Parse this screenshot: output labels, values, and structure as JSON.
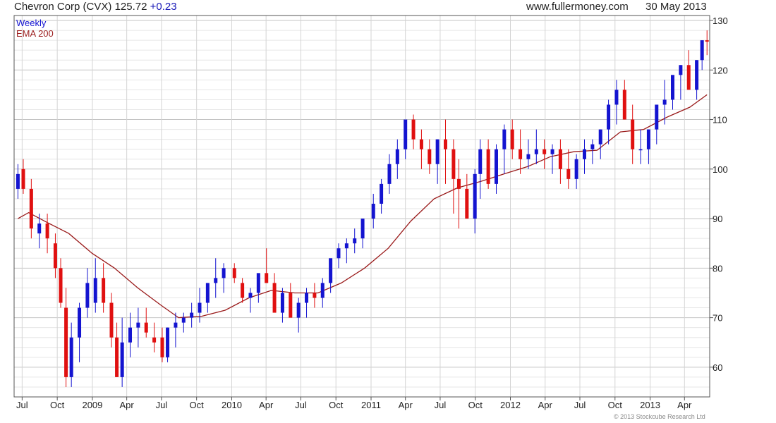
{
  "header": {
    "title": "Chevron Corp (CVX)",
    "last": "125.72",
    "change": "+0.23",
    "site": "www.fullermoney.com",
    "date": "30 May 2013"
  },
  "footer": {
    "copyright": "© 2013 Stockcube Research Ltd"
  },
  "colors": {
    "up": "#1414d0",
    "down": "#e01010",
    "ema": "#9a1b1b",
    "grid": "#cfcfcf"
  },
  "chart_data": {
    "type": "line",
    "legend": [
      "Weekly",
      "EMA 200"
    ],
    "legend_position": "top-left",
    "y_axis_position": "right",
    "grid": true,
    "ylim": [
      54,
      131
    ],
    "y_ticks": [
      60,
      70,
      80,
      90,
      100,
      110,
      120,
      130
    ],
    "x_ticks": [
      "Jul",
      "Oct",
      "2009",
      "Apr",
      "Jul",
      "Oct",
      "2010",
      "Apr",
      "Jul",
      "Oct",
      "2011",
      "Apr",
      "Jul",
      "Oct",
      "2012",
      "Apr",
      "Jul",
      "Oct",
      "2013",
      "Apr"
    ],
    "x_tick_dates": [
      "2008-07-01",
      "2008-10-01",
      "2009-01-01",
      "2009-04-01",
      "2009-07-01",
      "2009-10-01",
      "2010-01-01",
      "2010-04-01",
      "2010-07-01",
      "2010-10-01",
      "2011-01-01",
      "2011-04-01",
      "2011-07-01",
      "2011-10-01",
      "2012-01-01",
      "2012-04-01",
      "2012-07-01",
      "2012-10-01",
      "2013-01-01",
      "2013-04-01"
    ],
    "series": [
      {
        "name": "Weekly",
        "style": "candlestick",
        "dates": [
          "2008-06-20",
          "2008-07-04",
          "2008-07-25",
          "2008-08-15",
          "2008-09-05",
          "2008-09-26",
          "2008-10-10",
          "2008-10-24",
          "2008-11-07",
          "2008-11-28",
          "2008-12-19",
          "2009-01-09",
          "2009-01-30",
          "2009-02-20",
          "2009-03-06",
          "2009-03-20",
          "2009-04-10",
          "2009-05-01",
          "2009-05-22",
          "2009-06-12",
          "2009-07-03",
          "2009-07-17",
          "2009-08-07",
          "2009-08-28",
          "2009-09-18",
          "2009-10-09",
          "2009-10-30",
          "2009-11-20",
          "2009-12-11",
          "2010-01-08",
          "2010-01-29",
          "2010-02-19",
          "2010-03-12",
          "2010-04-02",
          "2010-04-23",
          "2010-05-14",
          "2010-06-04",
          "2010-06-25",
          "2010-07-16",
          "2010-08-06",
          "2010-08-27",
          "2010-09-17",
          "2010-10-08",
          "2010-10-29",
          "2010-11-19",
          "2010-12-10",
          "2011-01-07",
          "2011-01-28",
          "2011-02-18",
          "2011-03-11",
          "2011-04-01",
          "2011-04-22",
          "2011-05-13",
          "2011-06-03",
          "2011-06-24",
          "2011-07-15",
          "2011-08-05",
          "2011-08-19",
          "2011-09-09",
          "2011-09-30",
          "2011-10-14",
          "2011-11-04",
          "2011-11-25",
          "2011-12-16",
          "2012-01-06",
          "2012-01-27",
          "2012-02-17",
          "2012-03-09",
          "2012-03-30",
          "2012-04-20",
          "2012-05-11",
          "2012-06-01",
          "2012-06-22",
          "2012-07-13",
          "2012-08-03",
          "2012-08-24",
          "2012-09-14",
          "2012-10-05",
          "2012-10-26",
          "2012-11-16",
          "2012-12-07",
          "2012-12-28",
          "2013-01-18",
          "2013-02-08",
          "2013-03-01",
          "2013-03-22",
          "2013-04-12",
          "2013-05-03",
          "2013-05-17",
          "2013-05-30"
        ],
        "open": [
          96,
          100,
          96,
          87,
          89,
          85,
          80,
          72,
          58,
          66,
          72,
          73,
          78,
          73,
          66,
          58,
          65,
          68,
          69,
          66,
          66,
          62,
          68,
          69,
          70,
          71,
          73,
          77,
          78,
          80,
          77,
          74,
          75,
          79,
          77,
          71,
          75,
          70,
          73,
          75,
          74,
          77,
          82,
          84,
          85,
          86,
          90,
          93,
          97,
          101,
          104,
          110,
          106,
          104,
          101,
          106,
          104,
          98,
          96,
          90,
          99,
          104,
          97,
          104,
          108,
          104,
          102,
          103,
          104,
          103,
          104,
          100,
          98,
          102,
          104,
          105,
          108,
          113,
          116,
          110,
          104,
          104,
          108,
          113,
          114,
          119,
          121,
          116,
          122,
          126
        ],
        "high": [
          101,
          102,
          98,
          91,
          91,
          87,
          82,
          76,
          69,
          73,
          80,
          82,
          81,
          75,
          69,
          70,
          71,
          72,
          72,
          69,
          68,
          68,
          71,
          71,
          73,
          76,
          77,
          82,
          81,
          81,
          78,
          76,
          78,
          84,
          79,
          76,
          77,
          74,
          76,
          77,
          78,
          81,
          85,
          86,
          88,
          89,
          95,
          98,
          103,
          106,
          109,
          111,
          108,
          106,
          106,
          110,
          106,
          102,
          99,
          100,
          106,
          106,
          105,
          109,
          110,
          108,
          106,
          108,
          106,
          105,
          106,
          104,
          103,
          106,
          106,
          108,
          114,
          118,
          118,
          113,
          108,
          108,
          112,
          118,
          118,
          121,
          124,
          122,
          126,
          128
        ],
        "low": [
          94,
          95,
          86,
          84,
          83,
          78,
          72,
          56,
          56,
          61,
          70,
          71,
          71,
          64,
          58,
          56,
          62,
          64,
          66,
          63,
          61,
          61,
          64,
          67,
          68,
          69,
          71,
          74,
          75,
          77,
          73,
          71,
          73,
          77,
          73,
          69,
          71,
          67,
          70,
          72,
          72,
          75,
          80,
          81,
          83,
          84,
          88,
          91,
          95,
          98,
          102,
          104,
          100,
          99,
          97,
          97,
          91,
          88,
          90,
          87,
          94,
          96,
          95,
          99,
          102,
          99,
          100,
          101,
          100,
          99,
          97,
          96,
          96,
          99,
          101,
          102,
          105,
          109,
          110,
          101,
          101,
          101,
          105,
          109,
          112,
          114,
          116,
          114,
          120,
          123
        ],
        "close": [
          99,
          96,
          88,
          89,
          86,
          80,
          73,
          58,
          66,
          72,
          77,
          78,
          73,
          66,
          58,
          65,
          68,
          69,
          67,
          65,
          62,
          68,
          69,
          70,
          71,
          73,
          77,
          78,
          80,
          78,
          74,
          75,
          79,
          77,
          71,
          75,
          70,
          73,
          75,
          74,
          77,
          82,
          84,
          85,
          86,
          90,
          93,
          97,
          101,
          104,
          110,
          106,
          104,
          101,
          106,
          104,
          98,
          96,
          90,
          99,
          104,
          97,
          104,
          108,
          104,
          102,
          103,
          104,
          103,
          104,
          100,
          98,
          102,
          104,
          105,
          108,
          113,
          116,
          110,
          104,
          104,
          108,
          113,
          114,
          119,
          121,
          116,
          122,
          126,
          125.72
        ]
      },
      {
        "name": "EMA 200",
        "style": "line",
        "dates": [
          "2008-06-20",
          "2008-07-18",
          "2008-09-05",
          "2008-10-31",
          "2008-12-31",
          "2009-02-28",
          "2009-04-30",
          "2009-06-30",
          "2009-08-15",
          "2009-10-15",
          "2009-12-15",
          "2010-02-15",
          "2010-04-15",
          "2010-06-15",
          "2010-08-15",
          "2010-10-15",
          "2010-12-15",
          "2011-02-15",
          "2011-04-15",
          "2011-06-15",
          "2011-08-15",
          "2011-10-15",
          "2011-12-15",
          "2012-02-15",
          "2012-04-15",
          "2012-06-15",
          "2012-08-15",
          "2012-10-15",
          "2012-12-15",
          "2013-02-15",
          "2013-04-15",
          "2013-05-30"
        ],
        "values": [
          90,
          91.2,
          89.2,
          87,
          83,
          80,
          76,
          72.5,
          70,
          70.3,
          71.5,
          74,
          75.5,
          75,
          75,
          77,
          80,
          84,
          89.5,
          94,
          96.2,
          97.5,
          99,
          100.5,
          102.5,
          103.5,
          103.8,
          107.5,
          108,
          110.5,
          112.5,
          115
        ]
      }
    ]
  }
}
